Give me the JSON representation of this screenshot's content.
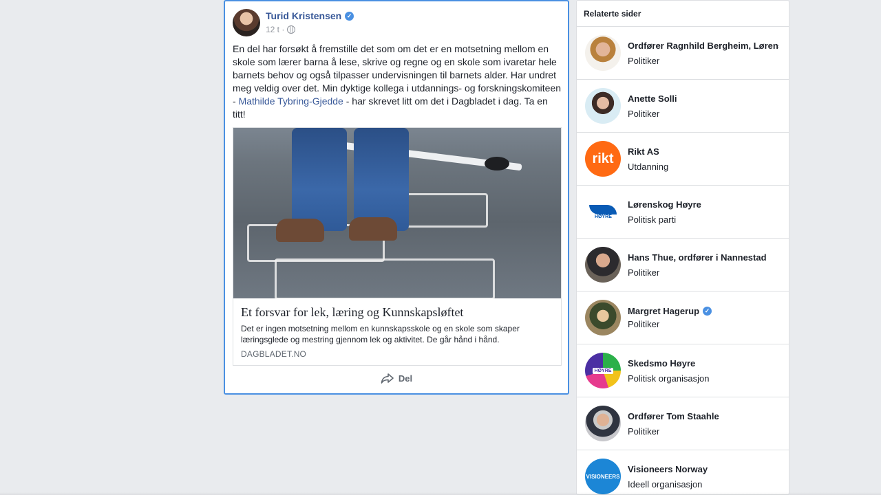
{
  "post": {
    "author": "Turid Kristensen",
    "verified": true,
    "time": "12 t ·",
    "text_before": "En del har forsøkt å fremstille det som om det er en motsetning mellom en skole som lærer barna å lese, skrive og regne og en skole som ivaretar hele barnets behov og også tilpasser undervisningen til barnets alder. Har undret meg veldig over det. Min dyktige kollega i utdannings- og forskningskomiteen - ",
    "mention": "Mathilde Tybring-Gjedde",
    "text_after": " - har skrevet litt om det i Dagbladet i dag. Ta en titt!",
    "link": {
      "title": "Et forsvar for lek, læring og Kunnskapsløftet",
      "description": "Det er ingen motsetning mellom en kunnskapsskole og en skole som skaper læringsglede og mestring gjennom lek og aktivitet. De går hånd i hånd.",
      "domain": "DAGBLADET.NO"
    },
    "share_label": "Del"
  },
  "related": {
    "title": "Relaterte sider",
    "items": [
      {
        "name": "Ordfører Ragnhild Bergheim, Lørenskog",
        "category": "Politiker"
      },
      {
        "name": "Anette Solli",
        "category": "Politiker"
      },
      {
        "name": "Rikt AS",
        "category": "Utdanning",
        "logo_text": "rikt"
      },
      {
        "name": "Lørenskog Høyre",
        "category": "Politisk parti",
        "logo_text": "HØYRE"
      },
      {
        "name": "Hans Thue, ordfører i Nannestad",
        "category": "Politiker"
      },
      {
        "name": "Margret Hagerup",
        "category": "Politiker",
        "verified": true
      },
      {
        "name": "Skedsmo Høyre",
        "category": "Politisk organisasjon",
        "logo_text": "HØYRE"
      },
      {
        "name": "Ordfører Tom Staahle",
        "category": "Politiker"
      },
      {
        "name": "Visioneers Norway",
        "category": "Ideell organisasjon",
        "logo_text": "VISIONEERS"
      }
    ]
  },
  "colors": {
    "link_blue": "#385898",
    "focus_border": "#4a90e2",
    "background": "#e9ebee"
  }
}
